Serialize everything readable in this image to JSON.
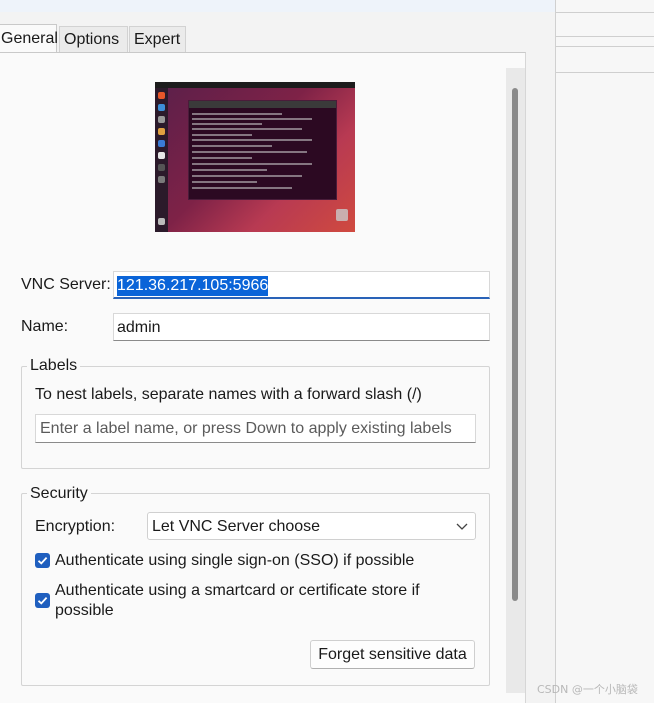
{
  "tabs": [
    {
      "label": "General",
      "active": true
    },
    {
      "label": "Options",
      "active": false
    },
    {
      "label": "Expert",
      "active": false
    }
  ],
  "preview": {
    "icon": "desktop-preview-thumbnail"
  },
  "vnc_server": {
    "label": "VNC Server:",
    "value": "121.36.217.105:5966"
  },
  "name": {
    "label": "Name:",
    "value": "admin"
  },
  "labels_group": {
    "title": "Labels",
    "hint": "To nest labels, separate names with a forward slash (/)",
    "placeholder": "Enter a label name, or press Down to apply existing labels"
  },
  "security_group": {
    "title": "Security",
    "encryption_label": "Encryption:",
    "encryption_value": "Let VNC Server choose",
    "sso_label": "Authenticate using single sign-on (SSO) if possible",
    "sso_checked": true,
    "smartcard_label_line1": "Authenticate using a smartcard or certificate store if",
    "smartcard_label_line2": "possible",
    "smartcard_checked": true,
    "forget_button": "Forget sensitive data"
  },
  "watermark": "CSDN @一个小脑袋",
  "colors": {
    "accent": "#1f5fbf",
    "selection": "#0a64d8"
  }
}
